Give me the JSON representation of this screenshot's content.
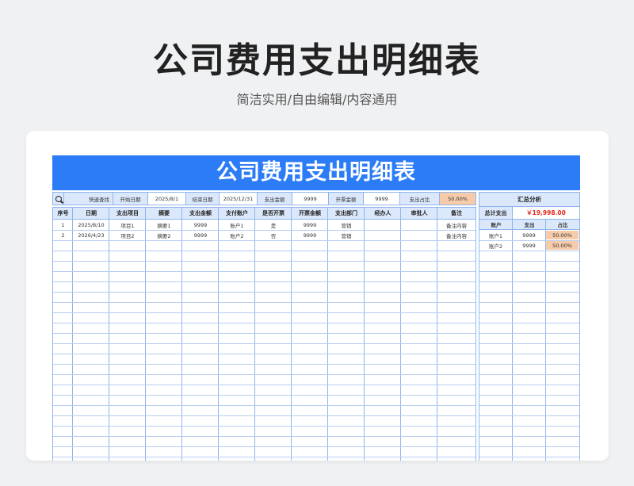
{
  "page": {
    "title": "公司费用支出明细表",
    "subtitle": "简洁实用/自由编辑/内容通用"
  },
  "sheet": {
    "banner_title": "公司费用支出明细表",
    "toolbar": {
      "quick_search": "快速查找",
      "start_date_label": "开始日期",
      "start_date_value": "2025/8/1",
      "end_date_label": "结束日期",
      "end_date_value": "2025/12/31",
      "expense_amount_label": "支出金额",
      "expense_amount_value": "9999",
      "invoice_amount_label": "开票金额",
      "invoice_amount_value": "9999",
      "expense_ratio_label": "支出占比",
      "expense_ratio_value": "50.00%"
    },
    "columns": [
      "序号",
      "日期",
      "支出项目",
      "摘要",
      "支出金额",
      "支付账户",
      "是否开票",
      "开票金额",
      "支出部门",
      "经办人",
      "审批人",
      "备注"
    ],
    "rows": [
      [
        "1",
        "2025/8/10",
        "项目1",
        "摘要1",
        "9999",
        "账户1",
        "是",
        "9999",
        "营销",
        "",
        "",
        "备注内容"
      ],
      [
        "2",
        "2026/4/23",
        "项目2",
        "摘要2",
        "9999",
        "账户2",
        "否",
        "9999",
        "营销",
        "",
        "",
        "备注内容"
      ]
    ]
  },
  "summary": {
    "title": "汇总分析",
    "total_label": "总计支出",
    "total_value": "￥19,998.00",
    "columns": [
      "账户",
      "支出",
      "占比"
    ],
    "rows": [
      [
        "账户1",
        "9999",
        "50.00%"
      ],
      [
        "账户2",
        "9999",
        "50.00%"
      ]
    ]
  },
  "colors": {
    "banner": "#2b7cf6",
    "header_fill": "#dbe8fb",
    "grid_line": "#8fb4ec",
    "percent_fill": "#f6cba9",
    "total_text": "#e0281c"
  },
  "icons": {
    "search": "search-icon"
  }
}
